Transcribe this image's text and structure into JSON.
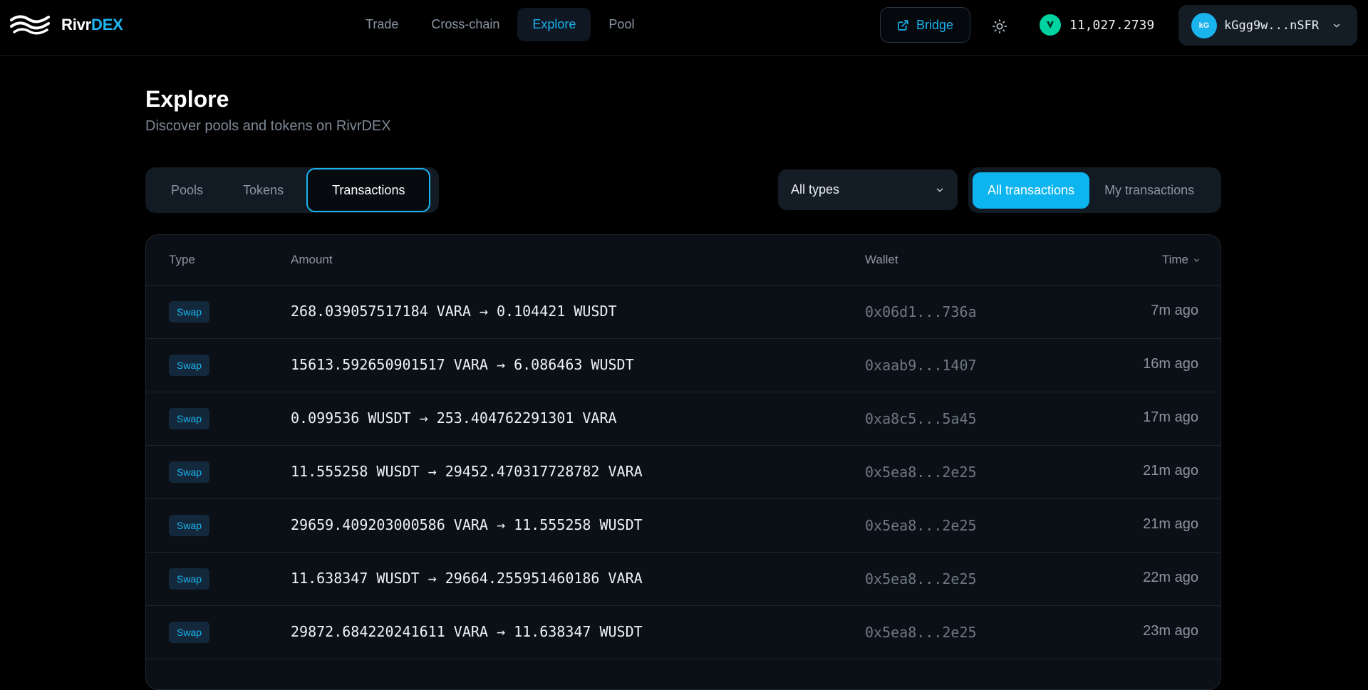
{
  "brand": {
    "name_part1": "Rivr",
    "name_part2": "DEX"
  },
  "nav": [
    {
      "label": "Trade",
      "active": false
    },
    {
      "label": "Cross-chain",
      "active": false
    },
    {
      "label": "Explore",
      "active": true
    },
    {
      "label": "Pool",
      "active": false
    }
  ],
  "header": {
    "bridge_label": "Bridge",
    "balance": "11,027.2739",
    "wallet_address": "kGgg9w...nSFR",
    "avatar_text": "kG"
  },
  "page": {
    "title": "Explore",
    "subtitle": "Discover pools and tokens on RivrDEX"
  },
  "tabs": [
    {
      "label": "Pools",
      "active": false
    },
    {
      "label": "Tokens",
      "active": false
    },
    {
      "label": "Transactions",
      "active": true
    }
  ],
  "filters": {
    "type_select": "All types",
    "scope": [
      {
        "label": "All transactions",
        "active": true
      },
      {
        "label": "My transactions",
        "active": false
      }
    ]
  },
  "table": {
    "columns": {
      "type": "Type",
      "amount": "Amount",
      "wallet": "Wallet",
      "time": "Time"
    },
    "rows": [
      {
        "type": "Swap",
        "amount": "268.039057517184 VARA → 0.104421 WUSDT",
        "wallet": "0x06d1...736a",
        "time": "7m ago"
      },
      {
        "type": "Swap",
        "amount": "15613.592650901517 VARA → 6.086463 WUSDT",
        "wallet": "0xaab9...1407",
        "time": "16m ago"
      },
      {
        "type": "Swap",
        "amount": "0.099536 WUSDT → 253.404762291301 VARA",
        "wallet": "0xa8c5...5a45",
        "time": "17m ago"
      },
      {
        "type": "Swap",
        "amount": "11.555258 WUSDT → 29452.470317728782 VARA",
        "wallet": "0x5ea8...2e25",
        "time": "21m ago"
      },
      {
        "type": "Swap",
        "amount": "29659.409203000586 VARA → 11.555258 WUSDT",
        "wallet": "0x5ea8...2e25",
        "time": "21m ago"
      },
      {
        "type": "Swap",
        "amount": "11.638347 WUSDT → 29664.255951460186 VARA",
        "wallet": "0x5ea8...2e25",
        "time": "22m ago"
      },
      {
        "type": "Swap",
        "amount": "29872.684220241611 VARA → 11.638347 WUSDT",
        "wallet": "0x5ea8...2e25",
        "time": "23m ago"
      }
    ]
  },
  "colors": {
    "accent": "#19b3ee",
    "background": "#000000",
    "panel": "#0b1016",
    "vara_green": "#00d3a2"
  },
  "icons": [
    "rivr-wave-logo",
    "external-link-icon",
    "sun-icon",
    "vara-token-icon",
    "chevron-down-icon"
  ]
}
